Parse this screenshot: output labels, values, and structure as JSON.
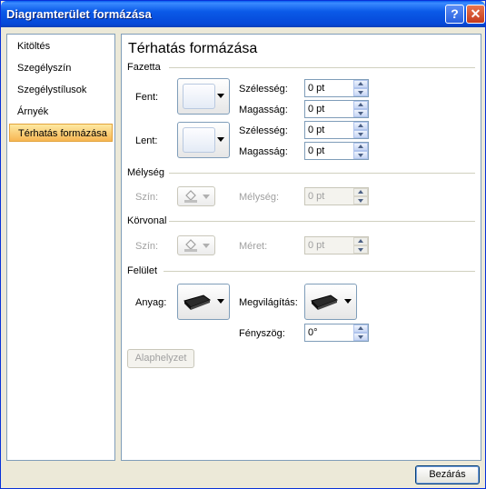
{
  "window": {
    "title": "Diagramterület formázása",
    "help_glyph": "?",
    "close_glyph": "✕"
  },
  "sidebar": {
    "items": [
      {
        "label": "Kitöltés"
      },
      {
        "label": "Szegélyszín"
      },
      {
        "label": "Szegélystílusok"
      },
      {
        "label": "Árnyék"
      },
      {
        "label": "Térhatás formázása"
      }
    ],
    "active_index": 4
  },
  "panel": {
    "title": "Térhatás formázása",
    "bevel": {
      "heading": "Fazetta",
      "top_label": "Fent:",
      "bottom_label": "Lent:",
      "top_width_label": "Szélesség:",
      "top_width_value": "0 pt",
      "top_height_label": "Magasság:",
      "top_height_value": "0 pt",
      "bottom_width_label": "Szélesség:",
      "bottom_width_value": "0 pt",
      "bottom_height_label": "Magasság:",
      "bottom_height_value": "0 pt"
    },
    "depth": {
      "heading": "Mélység",
      "color_label": "Szín:",
      "depth_label": "Mélység:",
      "depth_value": "0 pt"
    },
    "contour": {
      "heading": "Körvonal",
      "color_label": "Szín:",
      "size_label": "Méret:",
      "size_value": "0 pt"
    },
    "surface": {
      "heading": "Felület",
      "material_label": "Anyag:",
      "lighting_label": "Megvilágítás:",
      "angle_label": "Fényszög:",
      "angle_value": "0°"
    },
    "reset_label": "Alaphelyzet"
  },
  "footer": {
    "close_label": "Bezárás"
  },
  "colors": {
    "title_bar": "#0b5ae8",
    "accent_selected": "#f7b653",
    "dialog_bg": "#ece9d8"
  }
}
